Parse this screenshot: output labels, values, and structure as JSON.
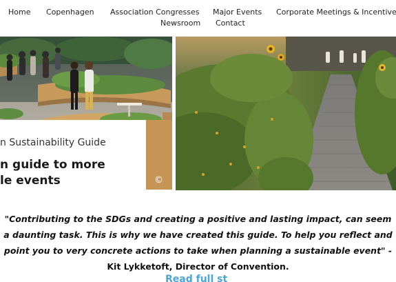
{
  "nav": {
    "items": [
      "Home",
      "Copenhagen",
      "Association Congresses",
      "Major Events",
      "Corporate Meetings & Incentives",
      "Newsroom",
      "Contact"
    ]
  },
  "hero": {
    "kicker": "n Sustainability Guide",
    "title_line_1": "n guide to more",
    "title_line_2": "le events",
    "copyright_symbol": "©"
  },
  "quote": {
    "line_1": "\"Contributing to the SDGs and creating a positive and lasting impact, can seem",
    "line_2": "a daunting task. This is why we have created this guide. To help you reflect and",
    "line_3": "point you to very concrete actions to take when planning a sustainable event\" -",
    "author": "Kit Lykketoft, Director of Convention."
  },
  "read_more": "Read full st",
  "colors": {
    "link": "#4aa6d6",
    "text": "#222222"
  }
}
